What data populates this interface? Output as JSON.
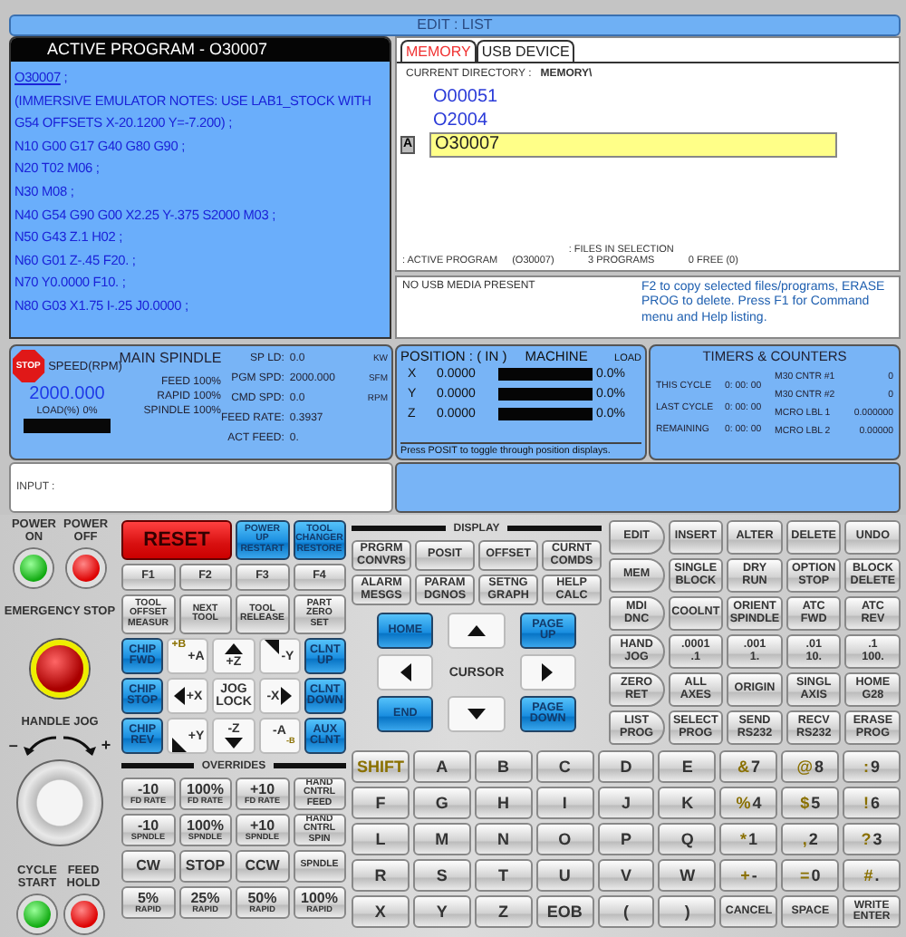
{
  "mode_bar": "EDIT : LIST",
  "program": {
    "title": "ACTIVE PROGRAM - O30007",
    "name": "O30007",
    "name_suffix": " ;",
    "lines": [
      "(IMMERSIVE EMULATOR NOTES: USE LAB1_STOCK WITH G54 OFFSETS X-20.1200 Y=-7.200) ;",
      "N10 G00 G17 G40 G80 G90 ;",
      "N20 T02 M06 ;",
      "N30 M08 ;",
      "N40 G54 G90 G00 X2.25 Y-.375 S2000 M03 ;",
      "N50 G43 Z.1 H02 ;",
      "N60 G01 Z-.45 F20. ;",
      "N70 Y0.0000 F10. ;",
      "N80 G03 X1.75 I-.25 J0.0000 ;"
    ]
  },
  "list": {
    "tabs": [
      {
        "label": "MEMORY",
        "selected": true
      },
      {
        "label": "USB DEVICE",
        "selected": false
      }
    ],
    "directory_label": "CURRENT DIRECTORY :",
    "directory": "MEMORY\\",
    "programs": [
      {
        "name": "O00051",
        "selected": false
      },
      {
        "name": "O2004",
        "selected": false
      },
      {
        "name": "O30007",
        "selected": true,
        "marker": "A"
      }
    ],
    "active_label": ": ACTIVE PROGRAM",
    "active": "(O30007)",
    "files_label": ": FILES IN SELECTION",
    "files": "3  PROGRAMS",
    "free": "0 FREE  (0)"
  },
  "usb_status": "NO USB MEDIA PRESENT",
  "help": "F2 to copy selected files/programs, ERASE PROG to delete. Press F1 for Command menu and Help listing.",
  "spindle": {
    "title": "MAIN SPINDLE",
    "stop": "STOP",
    "speed_label": "SPEED(RPM)",
    "speed": "2000.000",
    "load_label": "LOAD(%)",
    "load": "0%",
    "level": 0,
    "overrides": [
      {
        "label": "FEED",
        "value": "100%"
      },
      {
        "label": "RAPID",
        "value": "100%"
      },
      {
        "label": "SPINDLE",
        "value": "100%"
      }
    ],
    "readings": [
      {
        "label": "SP LD:",
        "value": "0.0",
        "unit": "KW"
      },
      {
        "label": "PGM SPD:",
        "value": "2000.000",
        "unit": "SFM"
      },
      {
        "label": "CMD SPD:",
        "value": "0.0",
        "unit": "RPM"
      },
      {
        "label": "FEED RATE:",
        "value": "0.3937"
      },
      {
        "label": "ACT FEED:",
        "value": "0."
      }
    ]
  },
  "position": {
    "title": "POSITION : ( IN )",
    "mode": "MACHINE",
    "load_label": "LOAD",
    "axes": [
      {
        "axis": "X",
        "value": "0.0000",
        "level": 0,
        "load": "0.0%"
      },
      {
        "axis": "Y",
        "value": "0.0000",
        "level": 0,
        "load": "0.0%"
      },
      {
        "axis": "Z",
        "value": "0.0000",
        "level": 0,
        "load": "0.0%"
      }
    ],
    "hint": "Press POSIT to toggle through position displays."
  },
  "timers": {
    "title": "TIMERS & COUNTERS",
    "timers": [
      {
        "label": "THIS CYCLE",
        "value": "0: 00: 00"
      },
      {
        "label": "LAST CYCLE",
        "value": "0: 00: 00"
      },
      {
        "label": "REMAINING",
        "value": "0: 00: 00"
      }
    ],
    "counters": [
      {
        "label": "M30 CNTR #1",
        "value": "0"
      },
      {
        "label": "M30 CNTR #2",
        "value": "0"
      },
      {
        "label": "MCRO LBL 1",
        "value": "0.000000"
      },
      {
        "label": "MCRO LBL 2",
        "value": "0.00000"
      }
    ]
  },
  "input": {
    "label": "INPUT :"
  },
  "power": [
    {
      "label": "POWER\nON",
      "kind": "green"
    },
    {
      "label": "POWER\nOFF",
      "kind": "red"
    }
  ],
  "emergency": "EMERGENCY STOP",
  "handle": {
    "label": "HANDLE JOG",
    "minus": "–",
    "plus": "+"
  },
  "cycle": [
    {
      "label": "CYCLE\nSTART",
      "kind": "green"
    },
    {
      "label": "FEED\nHOLD",
      "kind": "red"
    }
  ],
  "top_keys": [
    {
      "label": "RESET",
      "kind": "red"
    },
    {
      "label": "POWER\nUP\nRESTART",
      "kind": "blue"
    },
    {
      "label": "TOOL\nCHANGER\nRESTORE",
      "kind": "blue"
    }
  ],
  "f_keys": [
    {
      "label": "F1",
      "kind": "grey"
    },
    {
      "label": "F2",
      "kind": "grey"
    },
    {
      "label": "F3",
      "kind": "grey"
    },
    {
      "label": "F4",
      "kind": "grey"
    }
  ],
  "tool_keys": [
    {
      "label": "TOOL\nOFFSET\nMEASUR",
      "kind": "grey"
    },
    {
      "label": "NEXT\nTOOL",
      "kind": "grey"
    },
    {
      "label": "TOOL\nRELEASE",
      "kind": "grey"
    },
    {
      "label": "PART\nZERO\nSET",
      "kind": "grey"
    }
  ],
  "jog_keys": [
    {
      "label": "CHIP\nFWD",
      "kind": "blue"
    },
    {
      "label": "+A",
      "alt": "+B",
      "kind": "white"
    },
    {
      "label": "+Z",
      "kind": "up"
    },
    {
      "label": "-Y",
      "kind": "ne"
    },
    {
      "label": "CLNT\nUP",
      "kind": "blue"
    },
    {
      "label": "CHIP\nSTOP",
      "kind": "blue"
    },
    {
      "label": "+X",
      "kind": "left"
    },
    {
      "label": "JOG\nLOCK",
      "kind": "white"
    },
    {
      "label": "-X",
      "kind": "right"
    },
    {
      "label": "CLNT\nDOWN",
      "kind": "blue"
    },
    {
      "label": "CHIP\nREV",
      "kind": "blue"
    },
    {
      "label": "+Y",
      "kind": "sw"
    },
    {
      "label": "-Z",
      "kind": "down"
    },
    {
      "label": "-A",
      "sub": "-B",
      "kind": "white"
    },
    {
      "label": "AUX\nCLNT",
      "kind": "blue"
    }
  ],
  "overrides_label": "OVERRIDES",
  "override_keys": [
    {
      "label": "-10",
      "sub": "FD RATE",
      "kind": "grey"
    },
    {
      "label": "100%",
      "sub": "FD RATE",
      "kind": "grey"
    },
    {
      "label": "+10",
      "sub": "FD RATE",
      "kind": "grey"
    },
    {
      "label": "HAND\nCNTRL\nFEED",
      "kind": "small"
    },
    {
      "label": "-10",
      "sub": "SPNDLE",
      "kind": "grey"
    },
    {
      "label": "100%",
      "sub": "SPNDLE",
      "kind": "grey"
    },
    {
      "label": "+10",
      "sub": "SPNDLE",
      "kind": "grey"
    },
    {
      "label": "HAND\nCNTRL\nSPIN",
      "kind": "small"
    },
    {
      "label": "CW",
      "kind": "grey"
    },
    {
      "label": "STOP",
      "kind": "grey"
    },
    {
      "label": "CCW",
      "kind": "grey"
    },
    {
      "label": "SPNDLE",
      "kind": "small"
    },
    {
      "label": "5%",
      "sub": "RAPID",
      "kind": "grey"
    },
    {
      "label": "25%",
      "sub": "RAPID",
      "kind": "grey"
    },
    {
      "label": "50%",
      "sub": "RAPID",
      "kind": "grey"
    },
    {
      "label": "100%",
      "sub": "RAPID",
      "kind": "grey"
    }
  ],
  "display_label": "DISPLAY",
  "display_keys": [
    {
      "label": "PRGRM\nCONVRS",
      "kind": "grey"
    },
    {
      "label": "POSIT",
      "kind": "grey"
    },
    {
      "label": "OFFSET",
      "kind": "grey"
    },
    {
      "label": "CURNT\nCOMDS",
      "kind": "grey"
    },
    {
      "label": "ALARM\nMESGS",
      "kind": "grey"
    },
    {
      "label": "PARAM\nDGNOS",
      "kind": "grey"
    },
    {
      "label": "SETNG\nGRAPH",
      "kind": "grey"
    },
    {
      "label": "HELP\nCALC",
      "kind": "grey"
    }
  ],
  "cursor_label": "CURSOR",
  "cursor_keys": [
    {
      "label": "HOME",
      "kind": "blue"
    },
    {
      "kind": "up"
    },
    {
      "label": "PAGE\nUP",
      "kind": "blue"
    },
    {
      "kind": "left"
    },
    {
      "kind": "right"
    },
    {
      "label": "END",
      "kind": "blue"
    },
    {
      "kind": "down"
    },
    {
      "label": "PAGE\nDOWN",
      "kind": "blue"
    }
  ],
  "function_keys": [
    {
      "label": "EDIT",
      "kind": "mode"
    },
    {
      "label": "INSERT",
      "kind": "grey"
    },
    {
      "label": "ALTER",
      "kind": "grey"
    },
    {
      "label": "DELETE",
      "kind": "grey"
    },
    {
      "label": "UNDO",
      "kind": "grey"
    },
    {
      "label": "MEM",
      "kind": "mode"
    },
    {
      "label": "SINGLE\nBLOCK",
      "kind": "grey"
    },
    {
      "label": "DRY\nRUN",
      "kind": "grey"
    },
    {
      "label": "OPTION\nSTOP",
      "kind": "grey"
    },
    {
      "label": "BLOCK\nDELETE",
      "kind": "grey"
    },
    {
      "label": "MDI\nDNC",
      "kind": "mode"
    },
    {
      "label": "COOLNT",
      "kind": "grey"
    },
    {
      "label": "ORIENT\nSPINDLE",
      "kind": "grey"
    },
    {
      "label": "ATC\nFWD",
      "kind": "grey"
    },
    {
      "label": "ATC\nREV",
      "kind": "grey"
    },
    {
      "label": "HAND\nJOG",
      "kind": "mode"
    },
    {
      "label": ".0001\n.1",
      "kind": "grey"
    },
    {
      "label": ".001\n1.",
      "kind": "grey"
    },
    {
      "label": ".01\n10.",
      "kind": "grey"
    },
    {
      "label": ".1\n100.",
      "kind": "grey"
    },
    {
      "label": "ZERO\nRET",
      "kind": "mode"
    },
    {
      "label": "ALL\nAXES",
      "kind": "grey"
    },
    {
      "label": "ORIGIN",
      "kind": "grey"
    },
    {
      "label": "SINGL\nAXIS",
      "kind": "grey"
    },
    {
      "label": "HOME\nG28",
      "kind": "grey"
    },
    {
      "label": "LIST\nPROG",
      "kind": "mode"
    },
    {
      "label": "SELECT\nPROG",
      "kind": "grey"
    },
    {
      "label": "SEND\nRS232",
      "kind": "grey"
    },
    {
      "label": "RECV\nRS232",
      "kind": "grey"
    },
    {
      "label": "ERASE\nPROG",
      "kind": "grey"
    }
  ],
  "keypad": [
    {
      "label": "SHIFT",
      "kind": "shift"
    },
    {
      "label": "A",
      "kind": "grey"
    },
    {
      "label": "B",
      "kind": "grey"
    },
    {
      "label": "C",
      "kind": "grey"
    },
    {
      "label": "D",
      "kind": "grey"
    },
    {
      "label": "E",
      "kind": "grey"
    },
    {
      "label": "7",
      "alt": "&",
      "kind": "grey"
    },
    {
      "label": "8",
      "alt": "@",
      "kind": "grey"
    },
    {
      "label": "9",
      "alt": ":",
      "kind": "grey"
    },
    {
      "label": "F",
      "kind": "grey"
    },
    {
      "label": "G",
      "kind": "grey"
    },
    {
      "label": "H",
      "kind": "grey"
    },
    {
      "label": "I",
      "kind": "grey"
    },
    {
      "label": "J",
      "kind": "grey"
    },
    {
      "label": "K",
      "kind": "grey"
    },
    {
      "label": "4",
      "alt": "%",
      "kind": "grey"
    },
    {
      "label": "5",
      "alt": "$",
      "kind": "grey"
    },
    {
      "label": "6",
      "alt": "!",
      "kind": "grey"
    },
    {
      "label": "L",
      "kind": "grey"
    },
    {
      "label": "M",
      "kind": "grey"
    },
    {
      "label": "N",
      "kind": "grey"
    },
    {
      "label": "O",
      "kind": "grey"
    },
    {
      "label": "P",
      "kind": "grey"
    },
    {
      "label": "Q",
      "kind": "grey"
    },
    {
      "label": "1",
      "alt": "*",
      "kind": "grey"
    },
    {
      "label": "2",
      "alt": ",",
      "kind": "grey"
    },
    {
      "label": "3",
      "alt": "?",
      "kind": "grey"
    },
    {
      "label": "R",
      "kind": "grey"
    },
    {
      "label": "S",
      "kind": "grey"
    },
    {
      "label": "T",
      "kind": "grey"
    },
    {
      "label": "U",
      "kind": "grey"
    },
    {
      "label": "V",
      "kind": "grey"
    },
    {
      "label": "W",
      "kind": "grey"
    },
    {
      "label": "-",
      "alt": "+",
      "kind": "grey"
    },
    {
      "label": "0",
      "alt": "=",
      "kind": "grey"
    },
    {
      "label": ".",
      "alt": "#",
      "kind": "grey"
    },
    {
      "label": "X",
      "kind": "grey"
    },
    {
      "label": "Y",
      "kind": "grey"
    },
    {
      "label": "Z",
      "kind": "grey"
    },
    {
      "label": "EOB",
      "kind": "grey"
    },
    {
      "label": "(",
      "kind": "grey"
    },
    {
      "label": ")",
      "kind": "grey"
    },
    {
      "label": "CANCEL",
      "kind": "small"
    },
    {
      "label": "SPACE",
      "kind": "small"
    },
    {
      "label": "WRITE\nENTER",
      "kind": "enter"
    }
  ]
}
